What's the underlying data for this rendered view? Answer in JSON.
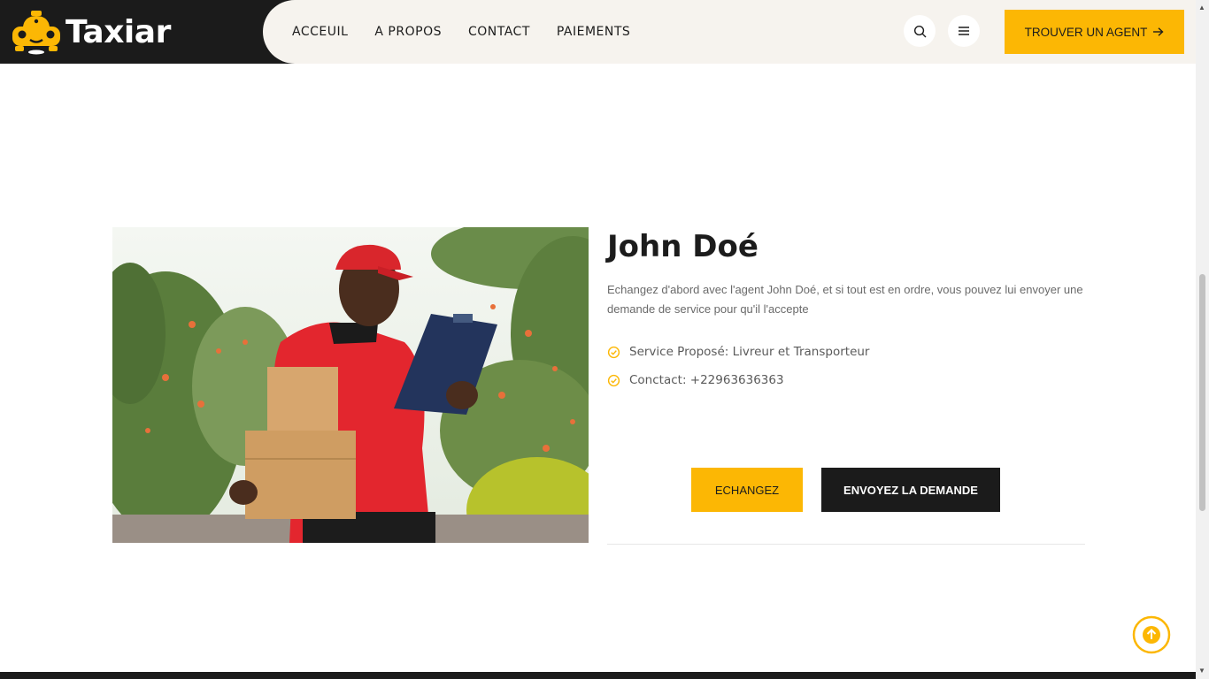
{
  "brand": {
    "name": "Taxiar",
    "accent_color": "#fcb704",
    "dark_color": "#1b1b1b"
  },
  "nav": {
    "items": [
      {
        "label": "ACCEUIL"
      },
      {
        "label": "A PROPOS"
      },
      {
        "label": "CONTACT"
      },
      {
        "label": "PAIEMENTS"
      }
    ],
    "search_icon": "search-icon",
    "menu_icon": "menu-icon",
    "cta_label": "TROUVER UN AGENT",
    "cta_icon": "arrow-right-icon"
  },
  "agent": {
    "name": "John Doé",
    "description": "Echangez d'abord avec l'agent John Doé, et si tout est en ordre, vous pouvez lui envoyer une demande de service pour qu'il l'accepte",
    "details": [
      {
        "icon": "check-circle-icon",
        "text": "Service Proposé: Livreur et Transporteur"
      },
      {
        "icon": "check-circle-icon",
        "text": "Conctact: +22963636363"
      }
    ],
    "buttons": {
      "exchange": "ECHANGEZ",
      "request": "ENVOYEZ LA DEMANDE"
    }
  },
  "back_to_top_icon": "arrow-up-icon"
}
